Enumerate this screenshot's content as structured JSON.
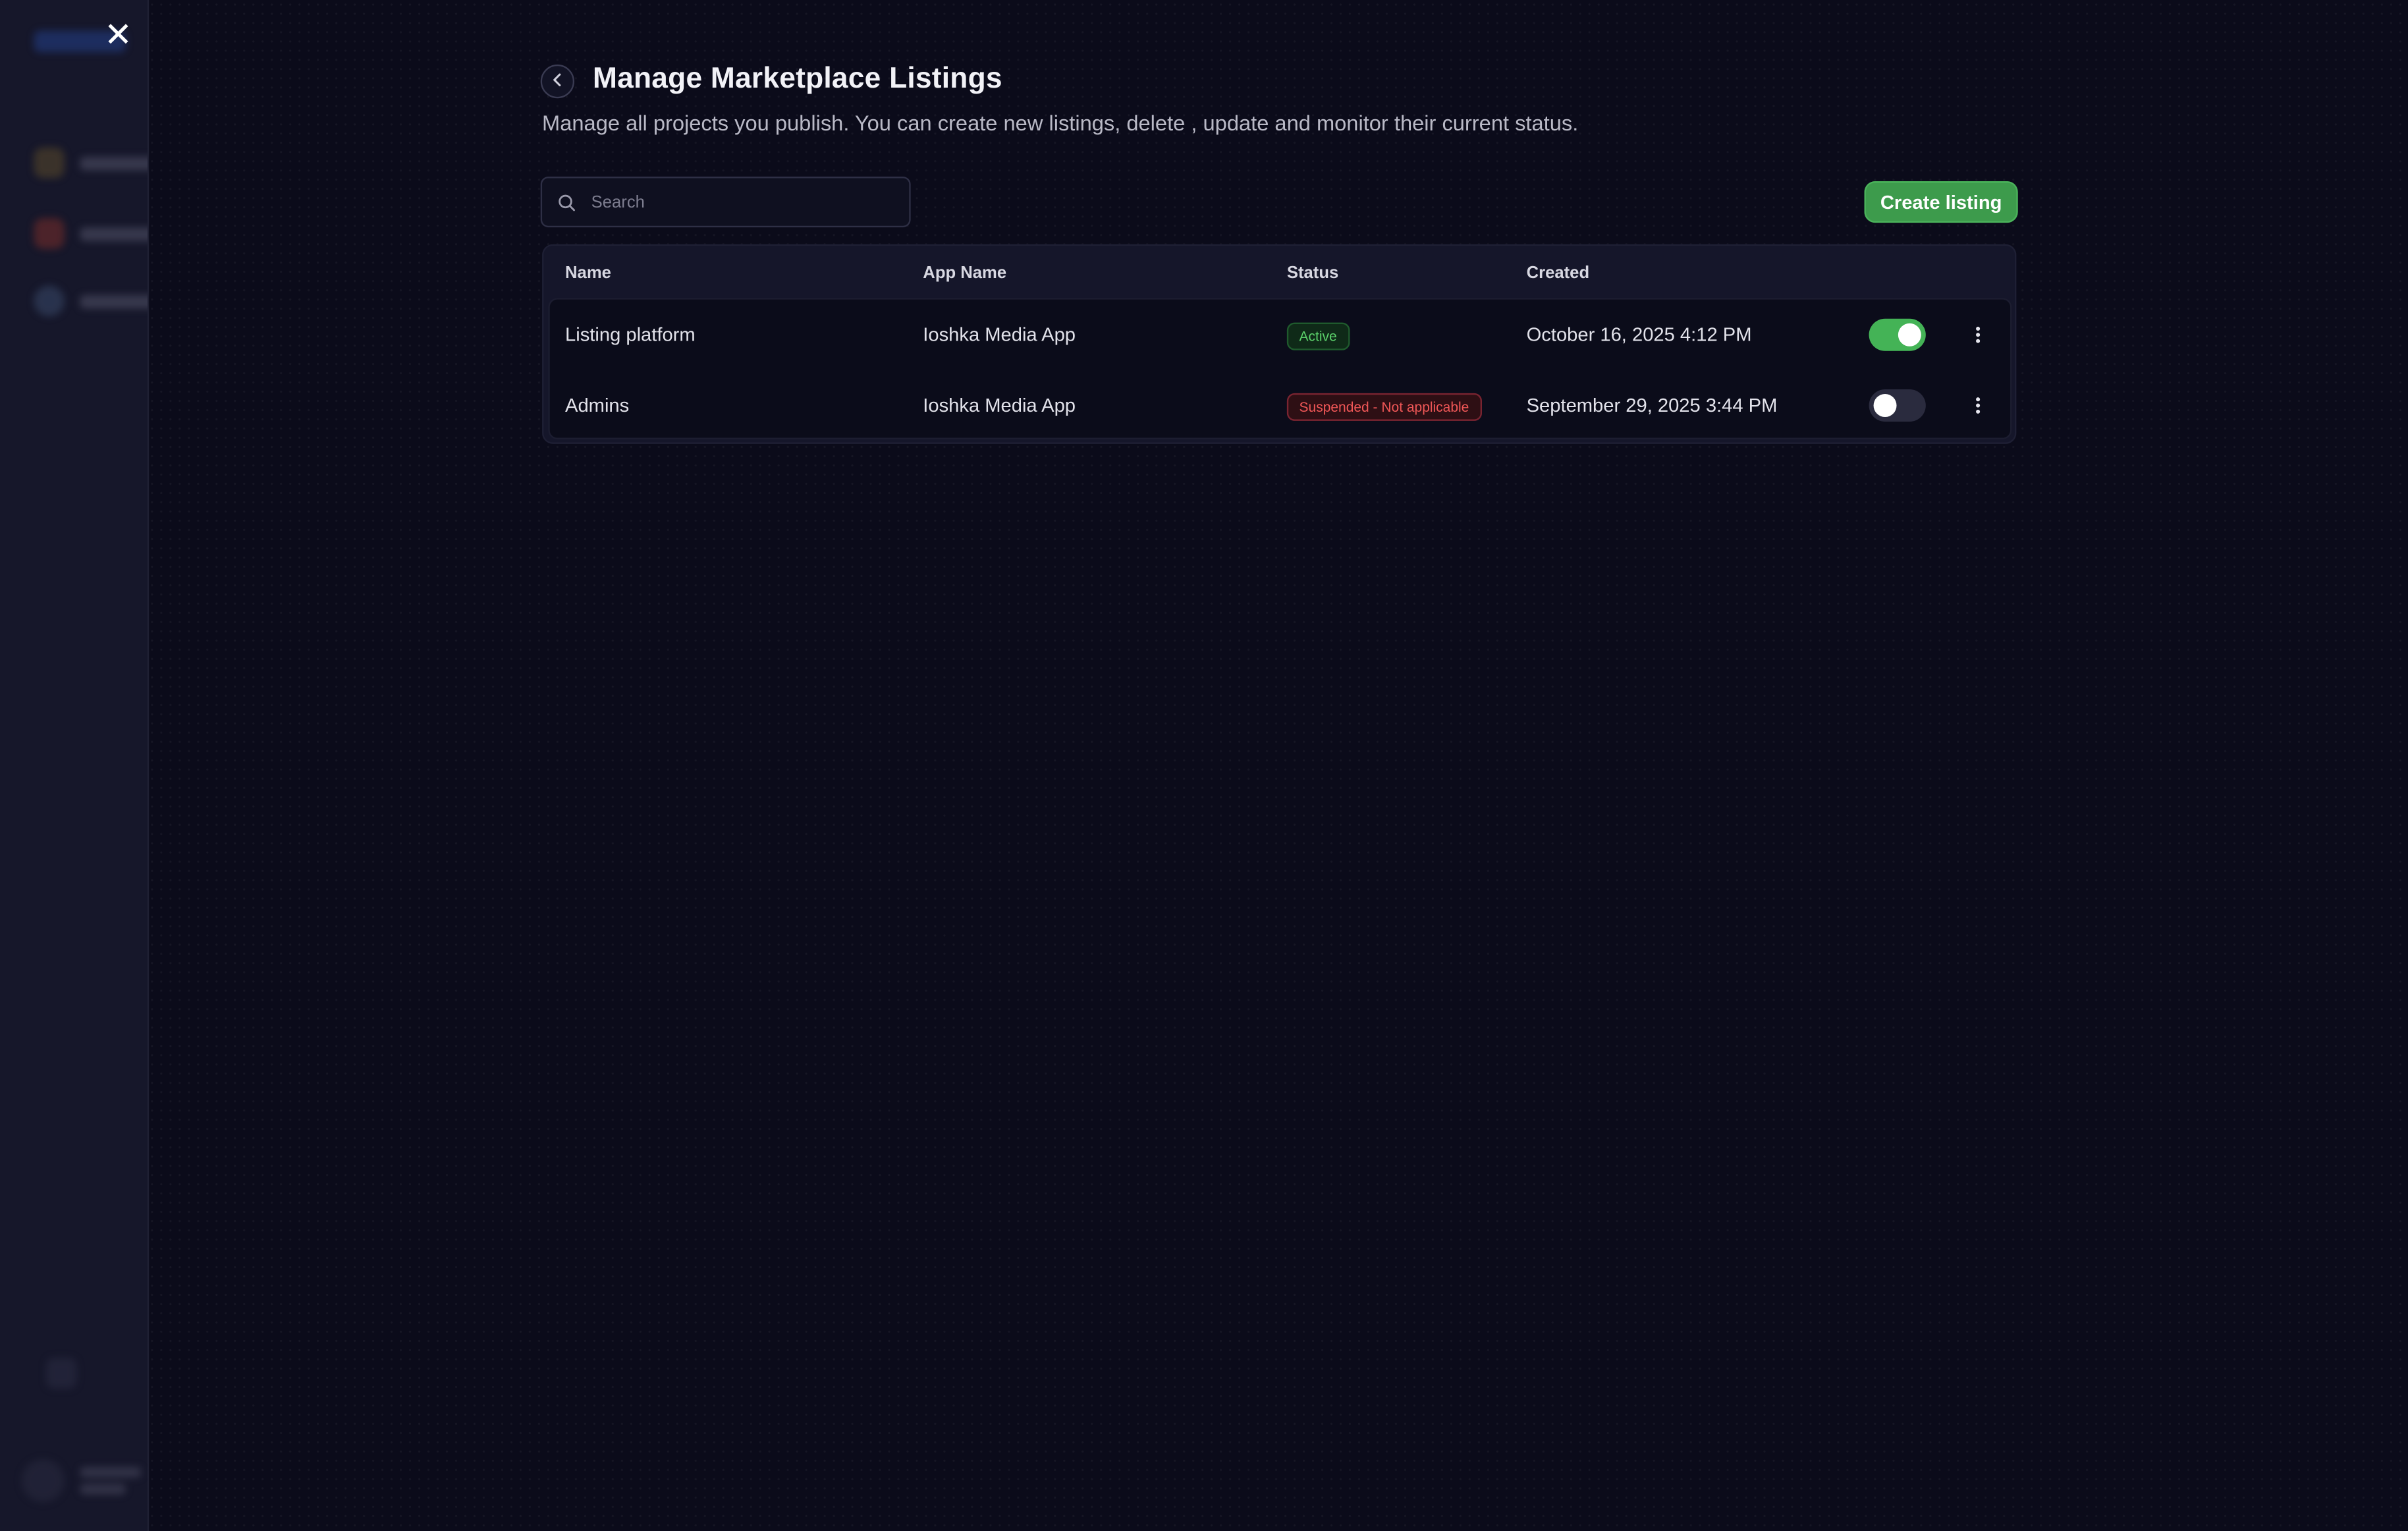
{
  "header": {
    "title": "Manage Marketplace Listings",
    "subtitle": "Manage all projects you publish. You can create new listings, delete , update and monitor their current status."
  },
  "search": {
    "placeholder": "Search",
    "value": ""
  },
  "actions": {
    "create_label": "Create listing"
  },
  "table": {
    "columns": [
      "Name",
      "App Name",
      "Status",
      "Created"
    ],
    "rows": [
      {
        "name": "Listing platform",
        "app_name": "Ioshka Media App",
        "status": "Active",
        "created": "October 16, 2025 4:12 PM",
        "enabled": true
      },
      {
        "name": "Admins",
        "app_name": "Ioshka Media App",
        "status": "Suspended - Not applicable",
        "created": "September 29, 2025 3:44 PM",
        "enabled": false
      }
    ]
  },
  "colors": {
    "background": "#0b0b1a",
    "accent_green": "#3d9b4c",
    "status_active": "#5bd06a",
    "status_suspended": "#f05757"
  },
  "icons": {
    "close": "close-icon",
    "back": "chevron-left-icon",
    "search": "search-icon",
    "row_menu": "more-vertical-icon"
  }
}
